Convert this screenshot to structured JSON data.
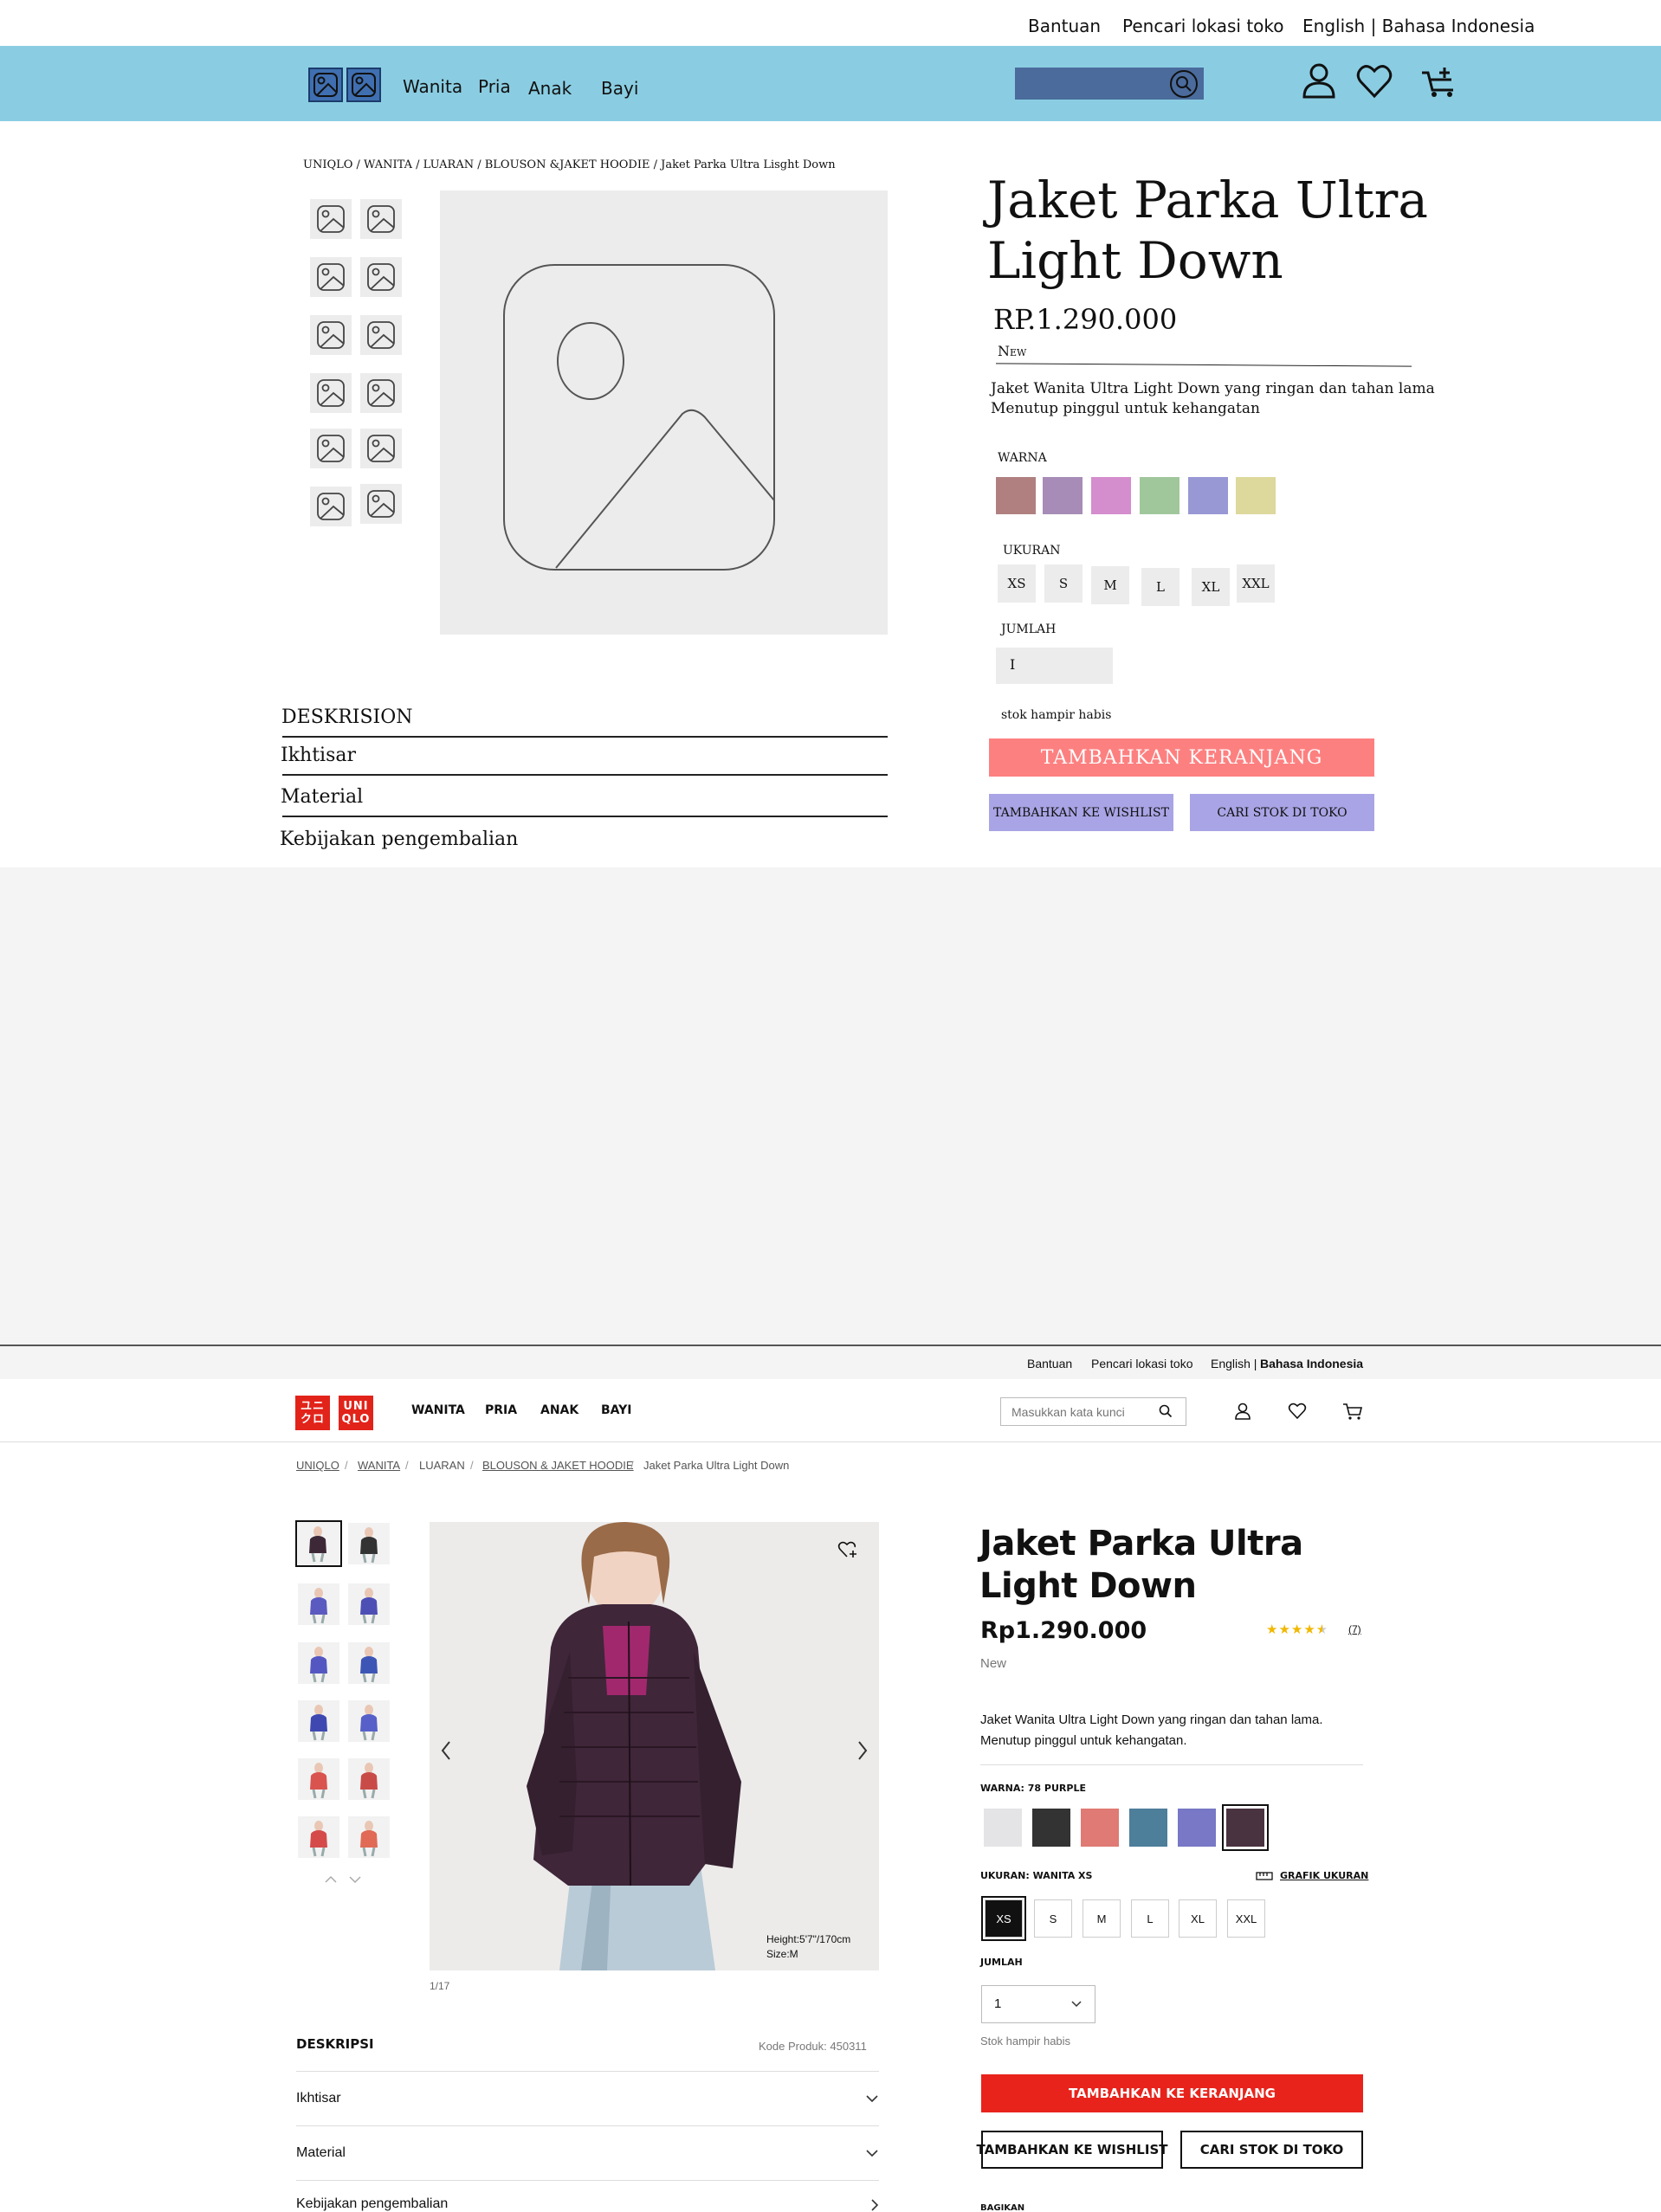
{
  "wireframe": {
    "top_links": [
      "Bantuan",
      "Pencari lokasi toko",
      "English | Bahasa Indonesia"
    ],
    "nav": [
      "Wanita",
      "Pria",
      "Anak",
      "Bayi"
    ],
    "breadcrumb": "UNIQLO / WANITA / LUARAN / BLOUSON &JAKET HOODIE / Jaket Parka Ultra Lisght Down",
    "title_line1": "Jaket Parka Ultra",
    "title_line2": "Light Down",
    "price": "RP.1.290.000",
    "badge": "New",
    "desc_line1": "Jaket Wanita Ultra Light Down yang ringan dan tahan lama",
    "desc_line2": "Menutup pinggul untuk kehangatan",
    "color_label": "WARNA",
    "colors": [
      "#b08080",
      "#a68cb6",
      "#d48dcd",
      "#a0c79c",
      "#9898d4",
      "#ddd89c"
    ],
    "size_label": "UKURAN",
    "sizes": [
      "XS",
      "S",
      "M",
      "L",
      "XL",
      "XXL"
    ],
    "qty_label": "JUMLAH",
    "qty_value": "I",
    "stock_note": "stok hampir habis",
    "cart_button": "TAMBAHKAN KERANJANG",
    "wishlist_button": "TAMBAHKAN KE WISHLIST",
    "stock_button": "CARI STOK DI TOKO",
    "desc_heading": "DESKRISION",
    "accordion": [
      "Ikhtisar",
      "Material",
      "Kebijakan pengembalian"
    ]
  },
  "page": {
    "top_links": [
      "Bantuan",
      "Pencari lokasi toko",
      "English | ",
      "Bahasa Indonesia"
    ],
    "logo": [
      "ユニ\nクロ",
      "UNI\nQLO"
    ],
    "nav": [
      "WANITA",
      "PRIA",
      "ANAK",
      "BAYI"
    ],
    "search_placeholder": "Masukkan kata kunci",
    "breadcrumb": [
      "UNIQLO",
      "WANITA",
      "LUARAN",
      "BLOUSON & JAKET HOODIE",
      "Jaket Parka Ultra Light Down"
    ],
    "breadcrumb_sep": "/",
    "title_line1": "Jaket Parka Ultra",
    "title_line2": "Light Down",
    "price": "Rp1.290.000",
    "rating_value": 4.5,
    "rating_count": "(7)",
    "badge": "New",
    "desc_line1": "Jaket Wanita Ultra Light Down yang ringan dan tahan lama.",
    "desc_line2": "Menutup pinggul untuk kehangatan.",
    "color_label": "WARNA: 78 PURPLE",
    "colors": [
      "#e4e4e6",
      "#333333",
      "#e07a74",
      "#4d7e9a",
      "#7878c6",
      "#4a3340"
    ],
    "selected_color_index": 5,
    "size_label": "UKURAN: WANITA XS",
    "size_chart": "GRAFIK UKURAN",
    "sizes": [
      "XS",
      "S",
      "M",
      "L",
      "XL",
      "XXL"
    ],
    "selected_size_index": 0,
    "qty_label": "JUMLAH",
    "qty_value": "1",
    "stock_note": "Stok hampir habis",
    "cart_button": "TAMBAHKAN KE KERANJANG",
    "wishlist_button": "TAMBAHKAN KE WISHLIST",
    "stock_button": "CARI STOK DI TOKO",
    "share_label": "BAGIKAN",
    "model_info_line1": "Height:5'7\"/170cm",
    "model_info_line2": "Size:M",
    "image_counter": "1/17",
    "desc_heading": "DESKRIPSI",
    "product_code": "Kode Produk: 450311",
    "accordion": [
      "Ikhtisar",
      "Material",
      "Kebijakan pengembalian"
    ]
  }
}
